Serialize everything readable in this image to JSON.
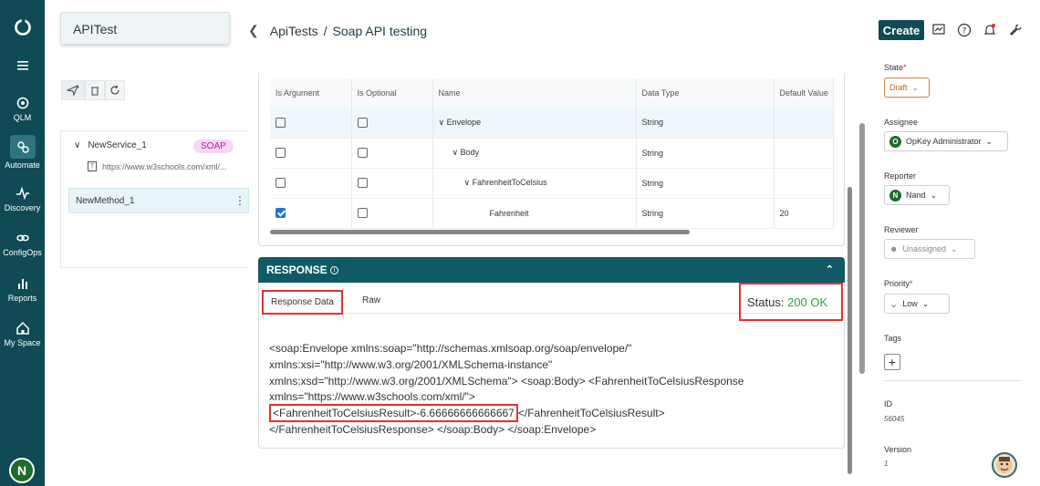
{
  "nav": {
    "items": [
      {
        "label": ""
      },
      {
        "label": ""
      },
      {
        "label": "QLM"
      },
      {
        "label": "Automate"
      },
      {
        "label": "Discovery"
      },
      {
        "label": "ConfigOps"
      },
      {
        "label": "Reports"
      },
      {
        "label": "My Space"
      }
    ],
    "user_initial": "N"
  },
  "header": {
    "project": "APITest",
    "breadcrumb_parent": "ApiTests",
    "breadcrumb_sep": "/",
    "breadcrumb_current": "Soap API testing",
    "create_label": "Create"
  },
  "service": {
    "name": "NewService_1",
    "type_badge": "SOAP",
    "url": "https://www.w3schools.com/xml/...",
    "method": "NewMethod_1"
  },
  "params": {
    "columns": [
      "Is Argument",
      "Is Optional",
      "Name",
      "Data Type",
      "Default Value"
    ],
    "rows": [
      {
        "is_argument": false,
        "is_optional": false,
        "name": "Envelope",
        "type": "String",
        "default": ""
      },
      {
        "is_argument": false,
        "is_optional": false,
        "name": "Body",
        "type": "String",
        "default": ""
      },
      {
        "is_argument": false,
        "is_optional": false,
        "name": "FahrenheitToCelsius",
        "type": "String",
        "default": ""
      },
      {
        "is_argument": true,
        "is_optional": false,
        "name": "Fahrenheit",
        "type": "String",
        "default": "20"
      }
    ]
  },
  "response": {
    "title": "RESPONSE",
    "tabs": [
      "Response Data",
      "Raw"
    ],
    "status_label": "Status:",
    "status_value": "200 OK",
    "xml": {
      "line1": "<soap:Envelope xmlns:soap=\"http://schemas.xmlsoap.org/soap/envelope/\"",
      "line2": "xmlns:xsi=\"http://www.w3.org/2001/XMLSchema-instance\"",
      "line3": "xmlns:xsd=\"http://www.w3.org/2001/XMLSchema\"> <soap:Body> <FahrenheitToCelsiusResponse",
      "line4": "xmlns=\"https://www.w3schools.com/xml/\">",
      "line5_highlight": "<FahrenheitToCelsiusResult>-6.66666666666667",
      "line5_rest": "</FahrenheitToCelsiusResult>",
      "line6": "</FahrenheitToCelsiusResponse> </soap:Body> </soap:Envelope>"
    }
  },
  "details": {
    "state_label": "State",
    "state_value": "Draft",
    "assignee_label": "Assignee",
    "assignee_initial": "O",
    "assignee_value": "OpKey Administrator",
    "reporter_label": "Reporter",
    "reporter_initial": "N",
    "reporter_value": "Nand",
    "reviewer_label": "Reviewer",
    "reviewer_value": "Unassigned",
    "priority_label": "Priority",
    "priority_value": "Low",
    "tags_label": "Tags",
    "id_label": "ID",
    "id_value": "56045",
    "version_label": "Version",
    "version_value": "1"
  },
  "colors": {
    "nav_bg": "#0f4a55",
    "accent": "#0f5a66",
    "status_ok": "#2e9e3d",
    "highlight_box": "#dd3333",
    "soap_badge": "#c0209b"
  }
}
